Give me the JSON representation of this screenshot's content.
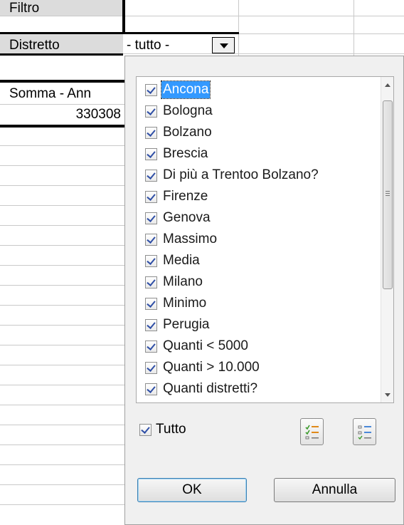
{
  "sheet": {
    "filter_label": "Filtro",
    "field_label": "Distretto",
    "data_header": "Somma - Ann",
    "data_value": "330308"
  },
  "combo": {
    "value": "- tutto -"
  },
  "popup": {
    "items": [
      {
        "label": "Ancona",
        "checked": true,
        "selected": true
      },
      {
        "label": "Bologna",
        "checked": true
      },
      {
        "label": "Bolzano",
        "checked": true
      },
      {
        "label": "Brescia",
        "checked": true
      },
      {
        "label": "Di più a Trentoo Bolzano?",
        "checked": true
      },
      {
        "label": "Firenze",
        "checked": true
      },
      {
        "label": "Genova",
        "checked": true
      },
      {
        "label": "Massimo",
        "checked": true
      },
      {
        "label": "Media",
        "checked": true
      },
      {
        "label": "Milano",
        "checked": true
      },
      {
        "label": "Minimo",
        "checked": true
      },
      {
        "label": "Perugia",
        "checked": true
      },
      {
        "label": "Quanti < 5000",
        "checked": true
      },
      {
        "label": "Quanti > 10.000",
        "checked": true
      },
      {
        "label": "Quanti distretti?",
        "checked": true
      }
    ],
    "all_label": "Tutto",
    "all_checked": true,
    "ok_label": "OK",
    "cancel_label": "Annulla",
    "select_all_icon": "check-list-icon",
    "select_none_icon": "uncheck-list-icon",
    "accent": "#3399ff"
  }
}
